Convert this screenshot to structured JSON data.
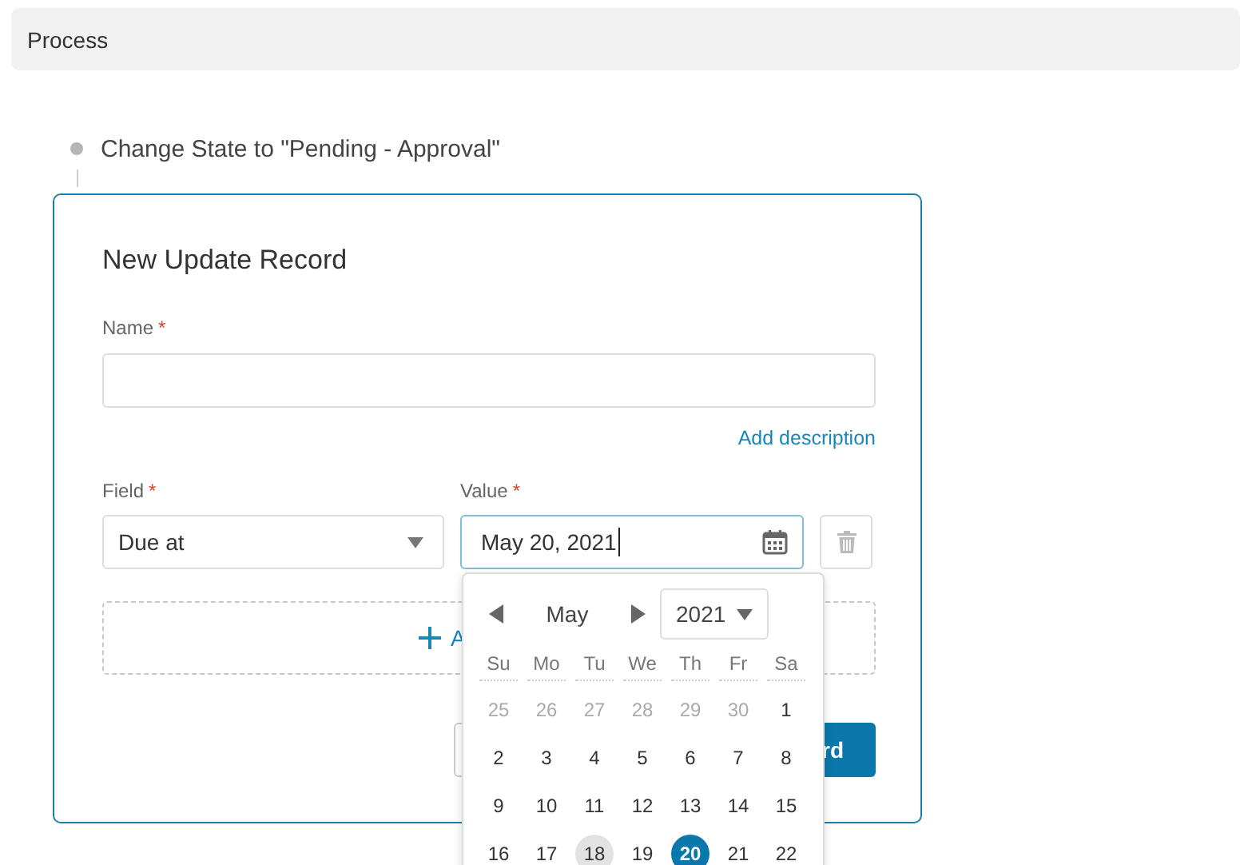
{
  "header": {
    "title": "Process"
  },
  "step": {
    "label": "Change State to \"Pending - Approval\""
  },
  "card": {
    "title": "New Update Record",
    "name_field": {
      "label": "Name",
      "required_mark": "*"
    },
    "add_description": "Add description",
    "field": {
      "label": "Field",
      "required_mark": "*",
      "value": "Due at"
    },
    "value": {
      "label": "Value",
      "required_mark": "*",
      "value": "May 20, 2021",
      "focused": true
    },
    "add_row": {
      "label": "A"
    },
    "save_button": {
      "label": "rd"
    }
  },
  "datepicker": {
    "month": "May",
    "year": "2021",
    "weekdays": [
      "Su",
      "Mo",
      "Tu",
      "We",
      "Th",
      "Fr",
      "Sa"
    ],
    "weeks": [
      [
        {
          "day": "25",
          "outside": true,
          "today": false,
          "selected": false
        },
        {
          "day": "26",
          "outside": true,
          "today": false,
          "selected": false
        },
        {
          "day": "27",
          "outside": true,
          "today": false,
          "selected": false
        },
        {
          "day": "28",
          "outside": true,
          "today": false,
          "selected": false
        },
        {
          "day": "29",
          "outside": true,
          "today": false,
          "selected": false
        },
        {
          "day": "30",
          "outside": true,
          "today": false,
          "selected": false
        },
        {
          "day": "1",
          "outside": false,
          "today": false,
          "selected": false
        }
      ],
      [
        {
          "day": "2",
          "outside": false,
          "today": false,
          "selected": false
        },
        {
          "day": "3",
          "outside": false,
          "today": false,
          "selected": false
        },
        {
          "day": "4",
          "outside": false,
          "today": false,
          "selected": false
        },
        {
          "day": "5",
          "outside": false,
          "today": false,
          "selected": false
        },
        {
          "day": "6",
          "outside": false,
          "today": false,
          "selected": false
        },
        {
          "day": "7",
          "outside": false,
          "today": false,
          "selected": false
        },
        {
          "day": "8",
          "outside": false,
          "today": false,
          "selected": false
        }
      ],
      [
        {
          "day": "9",
          "outside": false,
          "today": false,
          "selected": false
        },
        {
          "day": "10",
          "outside": false,
          "today": false,
          "selected": false
        },
        {
          "day": "11",
          "outside": false,
          "today": false,
          "selected": false
        },
        {
          "day": "12",
          "outside": false,
          "today": false,
          "selected": false
        },
        {
          "day": "13",
          "outside": false,
          "today": false,
          "selected": false
        },
        {
          "day": "14",
          "outside": false,
          "today": false,
          "selected": false
        },
        {
          "day": "15",
          "outside": false,
          "today": false,
          "selected": false
        }
      ],
      [
        {
          "day": "16",
          "outside": false,
          "today": false,
          "selected": false
        },
        {
          "day": "17",
          "outside": false,
          "today": false,
          "selected": false
        },
        {
          "day": "18",
          "outside": false,
          "today": true,
          "selected": false
        },
        {
          "day": "19",
          "outside": false,
          "today": false,
          "selected": false
        },
        {
          "day": "20",
          "outside": false,
          "today": false,
          "selected": true
        },
        {
          "day": "21",
          "outside": false,
          "today": false,
          "selected": false
        },
        {
          "day": "22",
          "outside": false,
          "today": false,
          "selected": false
        }
      ]
    ]
  }
}
